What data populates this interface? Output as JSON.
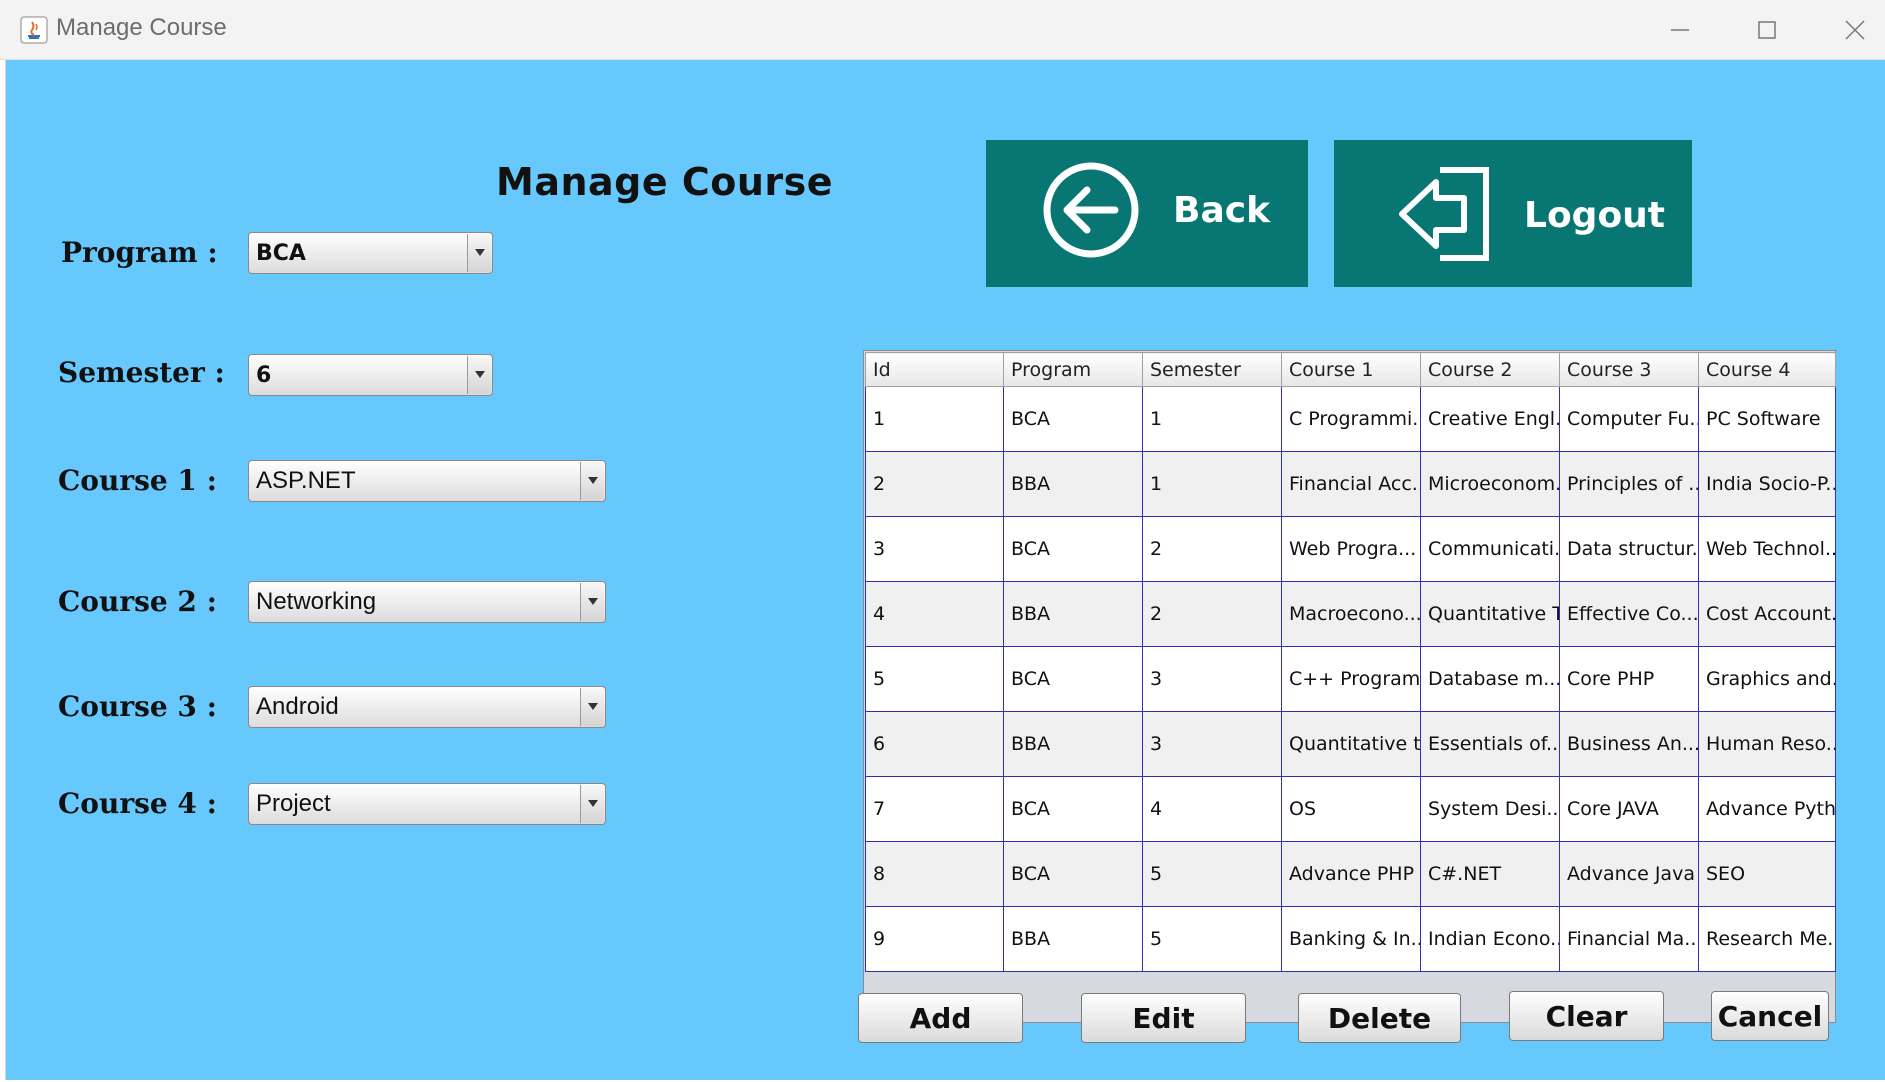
{
  "window": {
    "title": "Manage Course"
  },
  "page": {
    "title": "Manage Course"
  },
  "nav": {
    "back_label": "Back",
    "logout_label": "Logout"
  },
  "form": {
    "program_label": "Program :",
    "program_value": "BCA",
    "semester_label": "Semester :",
    "semester_value": "6",
    "course1_label": "Course 1 :",
    "course1_value": "ASP.NET",
    "course2_label": "Course 2 :",
    "course2_value": "Networking",
    "course3_label": "Course 3 :",
    "course3_value": "Android",
    "course4_label": "Course 4 :",
    "course4_value": "Project"
  },
  "table": {
    "columns": [
      "Id",
      "Program",
      "Semester",
      "Course 1",
      "Course 2",
      "Course 3",
      "Course 4"
    ],
    "rows": [
      [
        "1",
        "BCA",
        "1",
        "C Programmi...",
        "Creative Engl...",
        "Computer Fu...",
        "PC Software"
      ],
      [
        "2",
        "BBA",
        "1",
        "Financial Acc...",
        "Microeconom...",
        "Principles of ...",
        "India Socio-P..."
      ],
      [
        "3",
        "BCA",
        "2",
        "Web Progra...",
        "Communicati...",
        "Data structur...",
        "Web Technol..."
      ],
      [
        "4",
        "BBA",
        "2",
        "Macroecono...",
        "Quantitative T...",
        "Effective Co...",
        "Cost Account..."
      ],
      [
        "5",
        "BCA",
        "3",
        "C++ Program...",
        "Database m...",
        "Core PHP",
        "Graphics and..."
      ],
      [
        "6",
        "BBA",
        "3",
        "Quantitative t...",
        "Essentials of...",
        "Business An...",
        "Human Reso..."
      ],
      [
        "7",
        "BCA",
        "4",
        "OS",
        "System Desi...",
        "Core JAVA",
        "Advance Pyth..."
      ],
      [
        "8",
        "BCA",
        "5",
        "Advance PHP",
        "C#.NET",
        "Advance Java",
        "SEO"
      ],
      [
        "9",
        "BBA",
        "5",
        "Banking & In...",
        "Indian Econo...",
        "Financial Ma...",
        "Research Me..."
      ]
    ]
  },
  "actions": {
    "add": "Add",
    "edit": "Edit",
    "delete": "Delete",
    "clear": "Clear",
    "cancel": "Cancel"
  },
  "colors": {
    "background": "#66c8fc",
    "nav_button": "#087672",
    "grid_line": "#2f2fb7"
  },
  "icons": {
    "back": "arrow-left-circle-icon",
    "logout": "logout-arrow-icon",
    "dropdown": "caret-down-icon"
  }
}
